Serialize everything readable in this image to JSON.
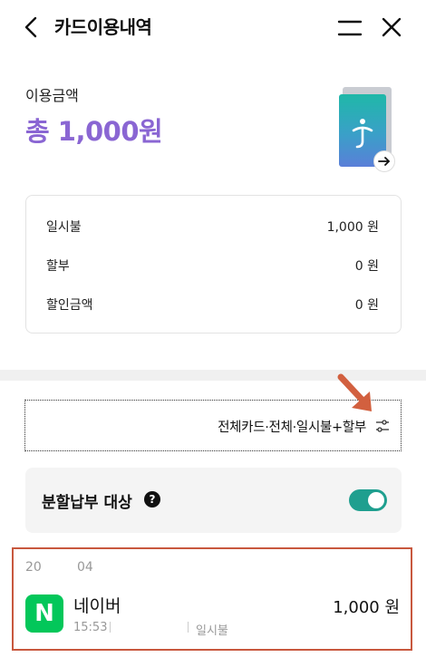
{
  "header": {
    "title": "카드이용내역",
    "back_icon": "chevron-left-icon",
    "menu_icon": "menu-icon",
    "close_icon": "close-icon"
  },
  "summary": {
    "label": "이용금액",
    "total": "총 1,000원",
    "accent_color": "#8a66d3",
    "rows": [
      {
        "label": "일시불",
        "value": "1,000 원"
      },
      {
        "label": "할부",
        "value": "0 원"
      },
      {
        "label": "할인금액",
        "value": "0 원"
      }
    ]
  },
  "card": {
    "arrow_icon": "arrow-right-icon"
  },
  "filter": {
    "text": "전체카드·전체·일시불+할부",
    "icon": "filter-sliders-icon"
  },
  "installment": {
    "label": "분할납부 대상",
    "help_icon": "question-icon",
    "help_text": "?",
    "toggle_on": true,
    "toggle_color": "#1f9f8f"
  },
  "transactions": [
    {
      "date_part1": "20",
      "date_part2": "04",
      "merchant": "네이버",
      "logo_letter": "N",
      "logo_color": "#03c75a",
      "time": "15:53",
      "type": "일시불",
      "amount": "1,000 원"
    }
  ]
}
